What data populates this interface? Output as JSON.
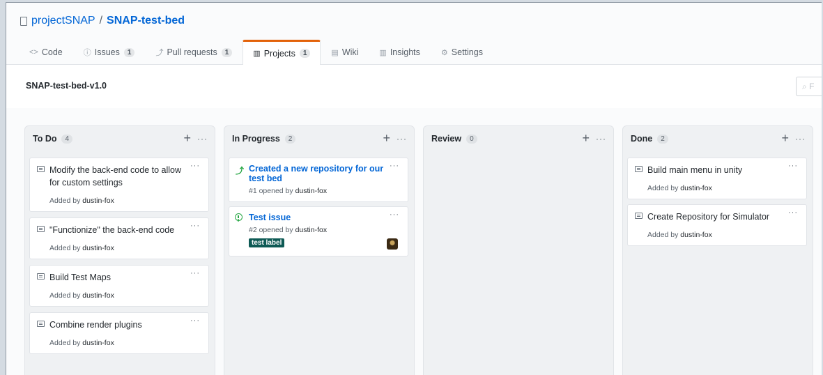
{
  "repo": {
    "owner": "projectSNAP",
    "separator": "/",
    "name": "SNAP-test-bed"
  },
  "tabs": [
    {
      "icon": "<>",
      "label": "Code"
    },
    {
      "icon": "ⓘ",
      "label": "Issues",
      "count": "1"
    },
    {
      "icon": "⤴",
      "label": "Pull requests",
      "count": "1"
    },
    {
      "icon": "▥",
      "label": "Projects",
      "count": "1",
      "active": true
    },
    {
      "icon": "▤",
      "label": "Wiki"
    },
    {
      "icon": "▥",
      "label": "Insights"
    },
    {
      "icon": "⚙",
      "label": "Settings"
    }
  ],
  "project": {
    "name": "SNAP-test-bed-v1.0",
    "filter_placeholder": "F"
  },
  "columns": [
    {
      "name": "To Do",
      "count": "4",
      "cards": [
        {
          "title": "Modify the back-end code to allow for custom settings",
          "added_prefix": "Added by",
          "author": "dustin-fox"
        },
        {
          "title": "\"Functionize\" the back-end code",
          "added_prefix": "Added by",
          "author": "dustin-fox"
        },
        {
          "title": "Build Test Maps",
          "added_prefix": "Added by",
          "author": "dustin-fox"
        },
        {
          "title": "Combine render plugins",
          "added_prefix": "Added by",
          "author": "dustin-fox"
        }
      ]
    },
    {
      "name": "In Progress",
      "count": "2",
      "cards": [
        {
          "title": "Created a new repository for our test bed",
          "opened_prefix": "#1 opened by",
          "author": "dustin-fox"
        },
        {
          "title": "Test issue",
          "opened_prefix": "#2 opened by",
          "author": "dustin-fox",
          "label": "test label"
        }
      ]
    },
    {
      "name": "Review",
      "count": "0",
      "cards": []
    },
    {
      "name": "Done",
      "count": "2",
      "cards": [
        {
          "title": "Build main menu in unity",
          "added_prefix": "Added by",
          "author": "dustin-fox"
        },
        {
          "title": "Create Repository for Simulator",
          "added_prefix": "Added by",
          "author": "dustin-fox"
        }
      ]
    }
  ],
  "icons": {
    "column_add": "+",
    "column_menu": "···",
    "card_menu": "···"
  },
  "colors": {
    "accent_tab": "#e36209",
    "link": "#0366d6",
    "open_green": "#28a745",
    "label_bg": "#0e5a55"
  }
}
